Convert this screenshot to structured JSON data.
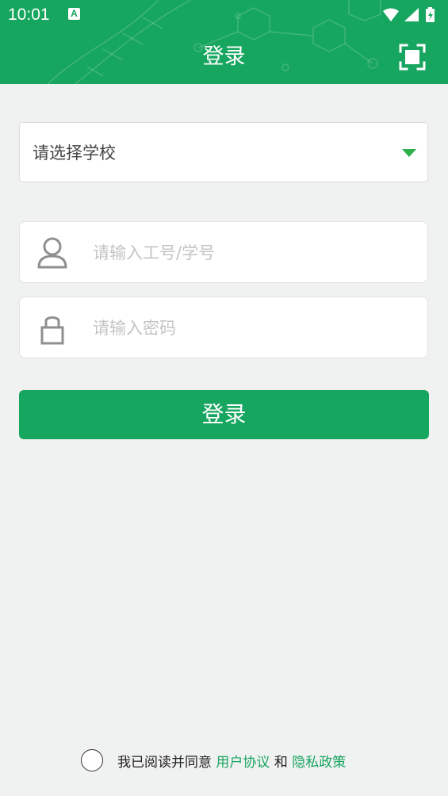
{
  "status_bar": {
    "time": "10:01",
    "notification_icon": "a-notification-icon",
    "icons": [
      "wifi-icon",
      "signal-icon",
      "battery-charging-icon"
    ]
  },
  "header": {
    "title": "登录",
    "scan_icon": "scan-icon",
    "background_color": "#17a65f"
  },
  "school_select": {
    "placeholder": "请选择学校",
    "dropdown_icon": "triangle-down-icon"
  },
  "username_field": {
    "placeholder": "请输入工号/学号",
    "value": "",
    "icon": "user-icon"
  },
  "password_field": {
    "placeholder": "请输入密码",
    "value": "",
    "icon": "lock-icon"
  },
  "login_button": {
    "label": "登录"
  },
  "agreement": {
    "checked": false,
    "prefix": "我已阅读并同意",
    "user_agreement": "用户协议",
    "conjunction": "和",
    "privacy_policy": "隐私政策",
    "link_color": "#17a65f"
  }
}
